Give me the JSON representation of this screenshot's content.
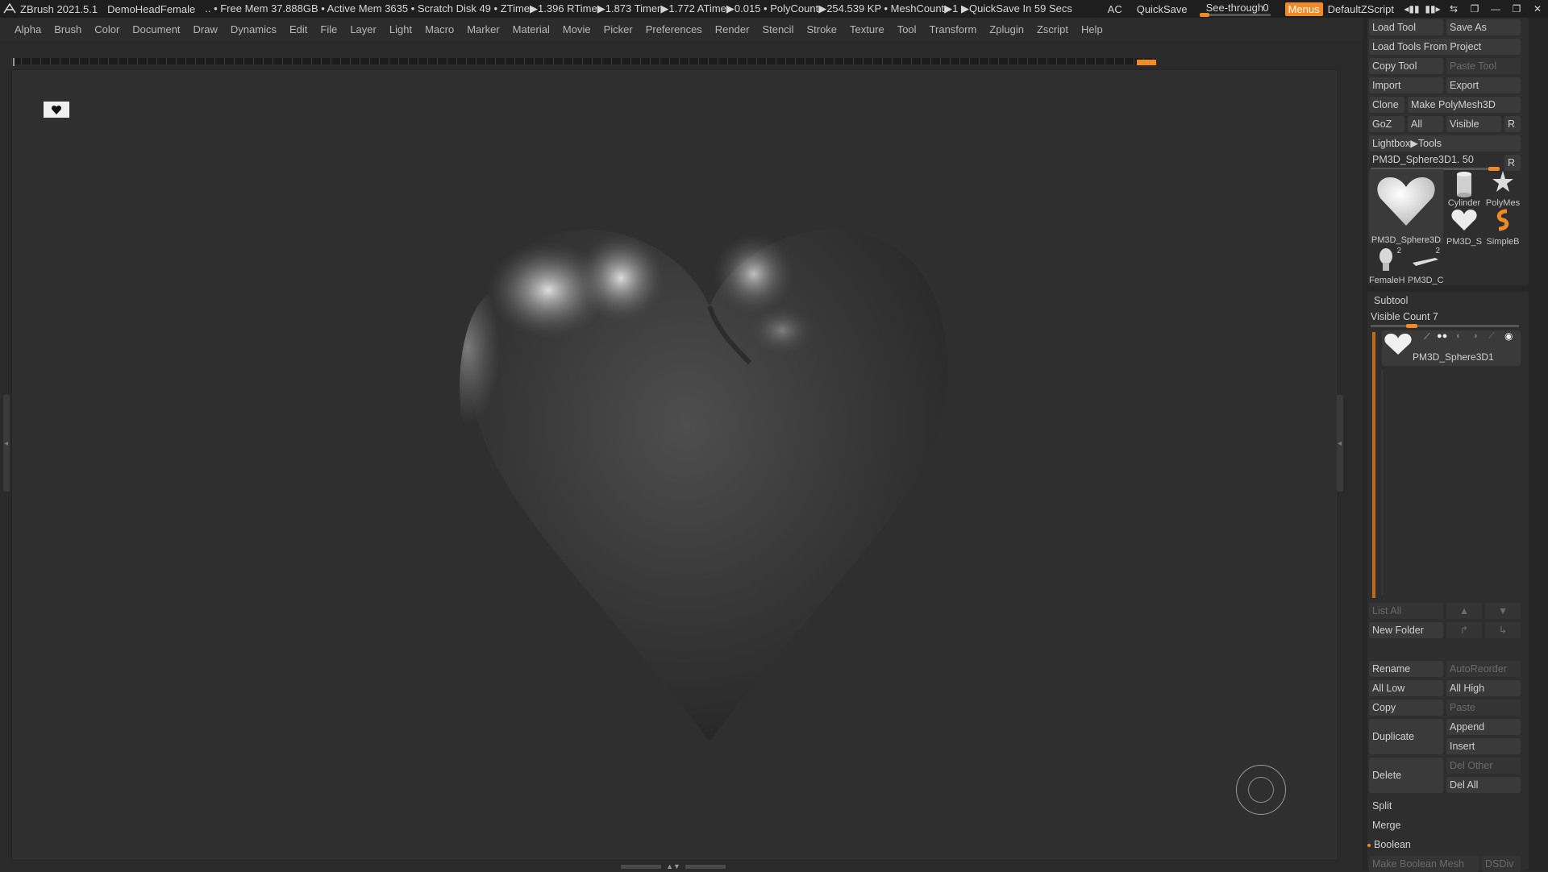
{
  "titlebar": {
    "app": "ZBrush 2021.5.1",
    "document": "DemoHeadFemale",
    "stats": ".. • Free Mem 37.888GB • Active Mem 3635 • Scratch Disk 49 • ZTime▶1.396 RTime▶1.873 Timer▶1.772 ATime▶0.015 • PolyCount▶254.539 KP • MeshCount▶1 ▶QuickSave In 59 Secs",
    "ac": "AC",
    "quicksave": "QuickSave",
    "seethrough_label": "See-through",
    "seethrough_value": "0",
    "menus": "Menus",
    "script": "DefaultZScript"
  },
  "menubar": [
    "Alpha",
    "Brush",
    "Color",
    "Document",
    "Draw",
    "Dynamics",
    "Edit",
    "File",
    "Layer",
    "Light",
    "Macro",
    "Marker",
    "Material",
    "Movie",
    "Picker",
    "Preferences",
    "Render",
    "Stencil",
    "Stroke",
    "Texture",
    "Tool",
    "Transform",
    "Zplugin",
    "Zscript",
    "Help"
  ],
  "colors": {
    "accent": "#f08a24",
    "panel": "#262626",
    "viewport": "#2f2f2f"
  },
  "tool": {
    "load_tool": "Load Tool",
    "save_as": "Save As",
    "load_from_project": "Load Tools From Project",
    "copy_tool": "Copy Tool",
    "paste_tool": "Paste Tool",
    "import": "Import",
    "export": "Export",
    "clone": "Clone",
    "make_polymesh": "Make PolyMesh3D",
    "goz": "GoZ",
    "all": "All",
    "visible": "Visible",
    "r": "R",
    "lightbox": "Lightbox▶Tools",
    "current_tool": "PM3D_Sphere3D1. 50",
    "thumbs": [
      {
        "caption": "PM3D_Sphere3D",
        "count": "",
        "icon": "heart-icon"
      },
      {
        "caption": "Cylinder",
        "count": "",
        "icon": "cylinder-icon"
      },
      {
        "caption": "PolyMes",
        "count": "",
        "icon": "star-icon"
      },
      {
        "caption": "PM3D_S",
        "count": "",
        "icon": "heart-small-icon"
      },
      {
        "caption": "SimpleB",
        "count": "",
        "icon": "simple-brush-icon"
      },
      {
        "caption": "FemaleH",
        "count": "2",
        "icon": "female-head-icon"
      },
      {
        "caption": "PM3D_C",
        "count": "2",
        "icon": "plane-icon"
      }
    ]
  },
  "subtool": {
    "title": "Subtool",
    "visible_count": "Visible Count 7",
    "item_name": "PM3D_Sphere3D1",
    "list_all": "List All",
    "new_folder": "New Folder",
    "rename": "Rename",
    "autoreorder": "AutoReorder",
    "all_low": "All Low",
    "all_high": "All High",
    "copy": "Copy",
    "paste": "Paste",
    "duplicate": "Duplicate",
    "append": "Append",
    "insert": "Insert",
    "delete": "Delete",
    "del_other": "Del Other",
    "del_all": "Del All",
    "split": "Split",
    "merge": "Merge",
    "boolean": "Boolean",
    "make_boolean_mesh": "Make Boolean Mesh",
    "dsdiv": "DSDiv"
  }
}
